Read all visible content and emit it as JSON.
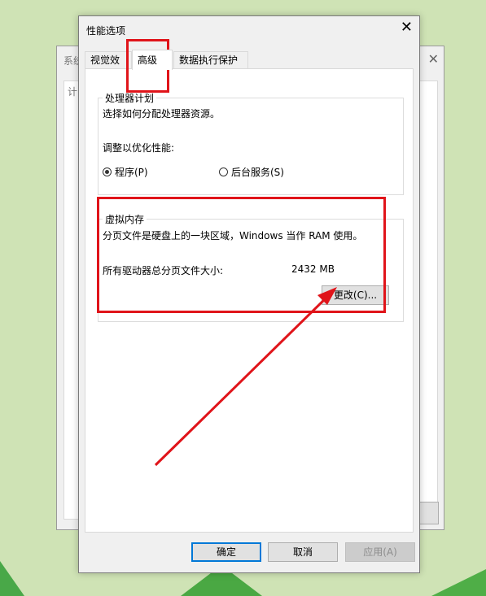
{
  "background_window": {
    "title_fragment": "系统",
    "tab_fragment": "计",
    "close_glyph": "✕"
  },
  "dialog": {
    "title": "性能选项",
    "close_glyph": "✕",
    "tabs": [
      {
        "label": "视觉效果",
        "active": false
      },
      {
        "label": "高级",
        "active": true
      },
      {
        "label": "数据执行保护",
        "active": false
      }
    ]
  },
  "processor": {
    "group_label": "处理器计划",
    "description": "选择如何分配处理器资源。",
    "adjust_label": "调整以优化性能:",
    "options": [
      {
        "label": "程序(P)",
        "checked": true
      },
      {
        "label": "后台服务(S)",
        "checked": false
      }
    ]
  },
  "virtual_memory": {
    "group_label": "虚拟内存",
    "description": "分页文件是硬盘上的一块区域，Windows 当作 RAM 使用。",
    "total_size_label": "所有驱动器总分页文件大小:",
    "total_size_value": "2432 MB",
    "change_button": "更改(C)..."
  },
  "footer": {
    "ok": "确定",
    "cancel": "取消",
    "apply": "应用(A)"
  },
  "annotation_color": "#e0141a"
}
